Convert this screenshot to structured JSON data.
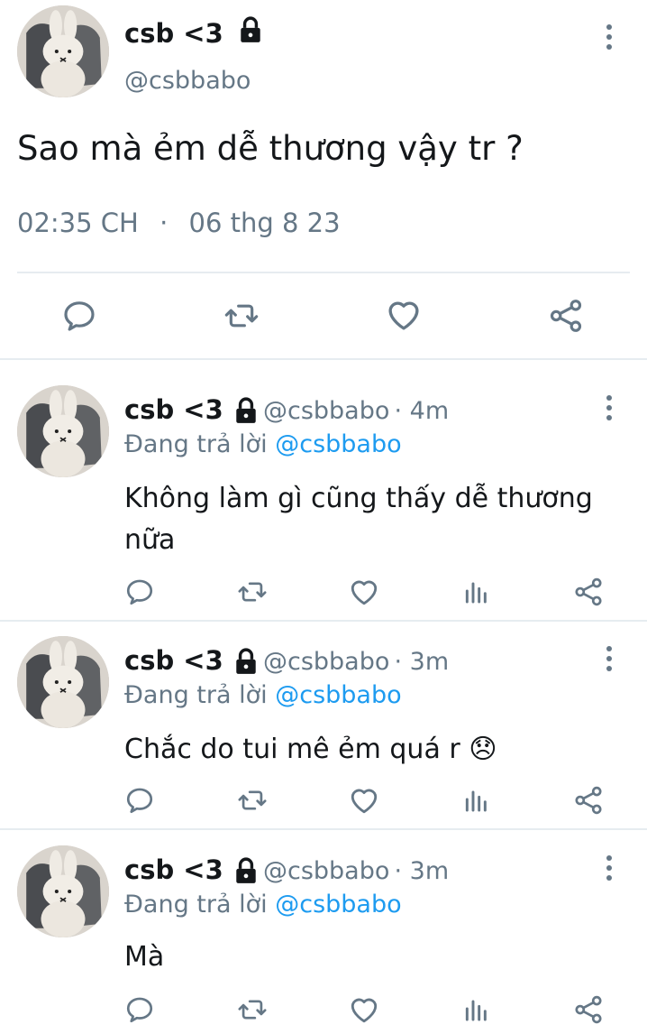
{
  "main_tweet": {
    "author_name": "csb <3",
    "author_handle": "@csbbabo",
    "text": "Sao mà ẻm dễ thương vậy tr ?",
    "time": "02:35 CH",
    "separator": "·",
    "date": "06 thg 8 23"
  },
  "replies": [
    {
      "author_name": "csb <3",
      "author_handle": "@csbbabo",
      "age": "· 4m",
      "replying_prefix": "Đang trả lời",
      "replying_to": "@csbbabo",
      "text_line1": "Không làm gì cũng thấy dễ thương",
      "text_line2": "nữa"
    },
    {
      "author_name": "csb <3",
      "author_handle": "@csbbabo",
      "age": "· 3m",
      "replying_prefix": "Đang trả lời",
      "replying_to": "@csbbabo",
      "text_line1": "Chắc do tui mê ẻm quá r 😞",
      "text_line2": ""
    },
    {
      "author_name": "csb <3",
      "author_handle": "@csbbabo",
      "age": "· 3m",
      "replying_prefix": "Đang trả lời",
      "replying_to": "@csbbabo",
      "text_line1": "Mà",
      "text_line2": ""
    }
  ],
  "icons": {
    "lock": "lock-icon",
    "more": "more-vertical-icon",
    "reply": "reply-icon",
    "retweet": "retweet-icon",
    "like": "heart-icon",
    "views": "views-icon",
    "share": "share-icon"
  },
  "colors": {
    "text": "#14171a",
    "secondary": "#657786",
    "link": "#1d9bf0",
    "divider": "#e6ecf0"
  }
}
